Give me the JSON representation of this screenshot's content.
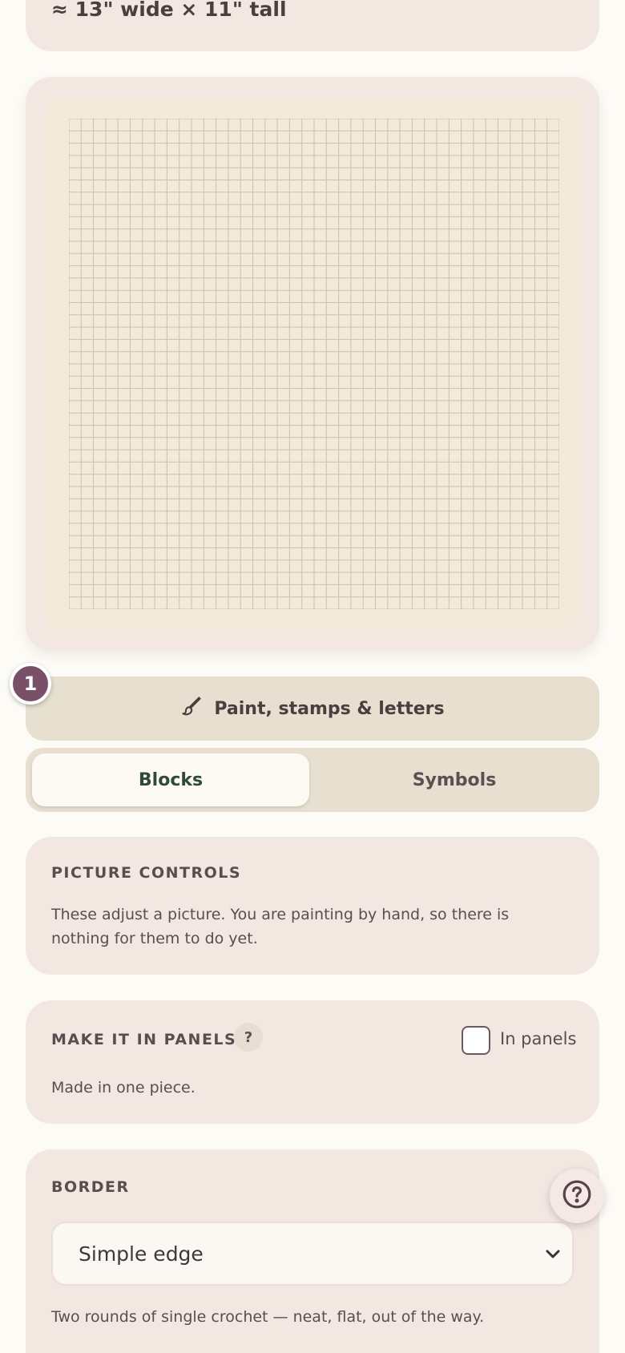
{
  "size": {
    "label": "≈ 13\" wide × 11\" tall"
  },
  "step": {
    "number": "1"
  },
  "paint_button": {
    "label": "Paint, stamps & letters",
    "icon": "brush-icon"
  },
  "mode_tabs": [
    {
      "label": "Blocks",
      "active": true
    },
    {
      "label": "Symbols",
      "active": false
    }
  ],
  "picture_controls": {
    "title": "PICTURE CONTROLS",
    "text": "These adjust a picture. You are painting by hand, so there is nothing for them to do yet."
  },
  "panels": {
    "title": "MAKE IT IN PANELS",
    "help": "?",
    "checkbox_label": "In panels",
    "checked": false,
    "text": "Made in one piece."
  },
  "border": {
    "title": "BORDER",
    "selected": "Simple edge",
    "text": "Two rounds of single crochet — neat, flat, out of the way."
  },
  "colors": {
    "accent": "#7a4f68",
    "card": "#f3e7e1",
    "grid": "#cdbfb0",
    "canvas": "#f4eadc"
  }
}
